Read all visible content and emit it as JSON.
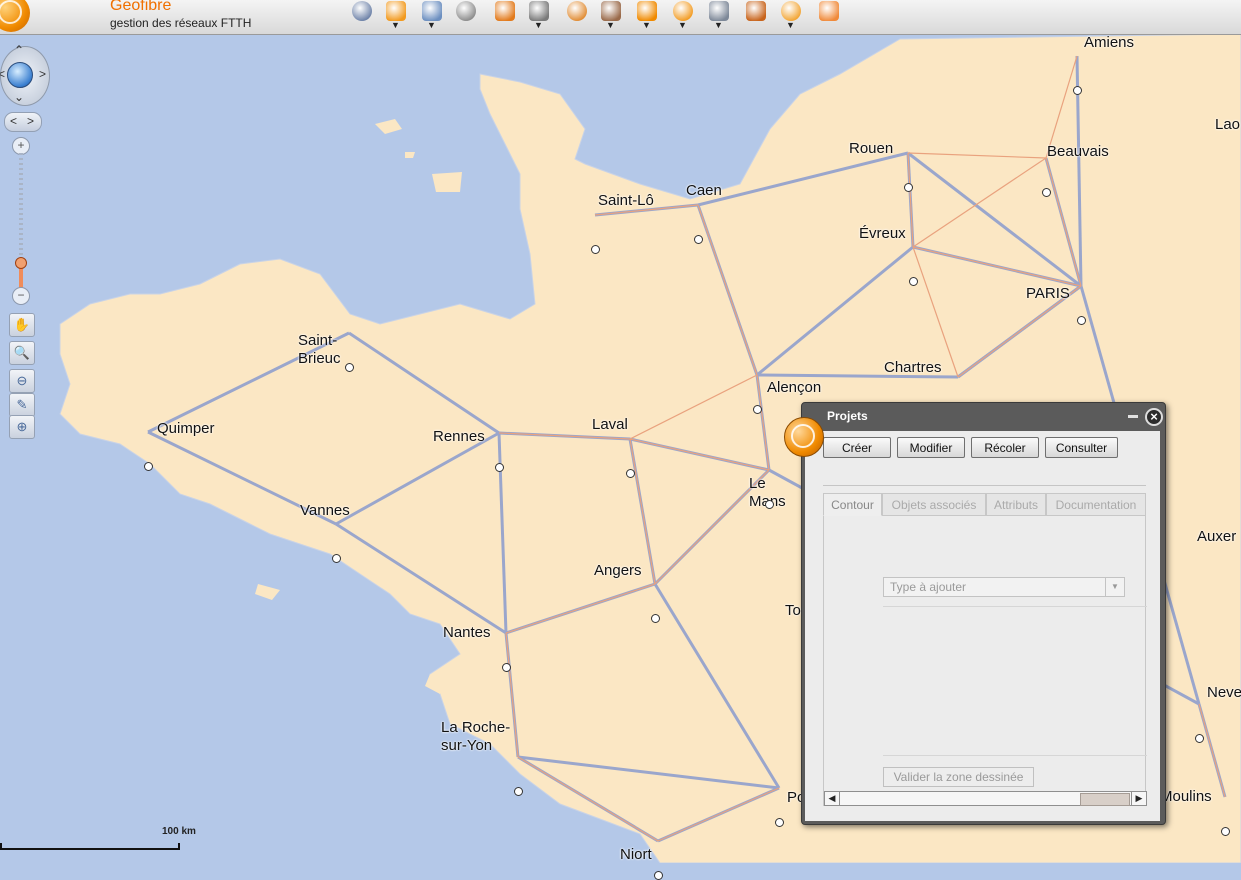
{
  "app": {
    "title": "Geofibre",
    "subtitle": "gestion des réseaux FTTH"
  },
  "toolbar": {
    "tools": [
      {
        "icon": "map-pin-icon",
        "color": "#6a7fa6",
        "dropdown": false
      },
      {
        "icon": "target-icon",
        "color": "#f29a1f",
        "dropdown": true
      },
      {
        "icon": "layers-icon",
        "color": "#6c8fc0",
        "dropdown": true
      },
      {
        "icon": "person-icon",
        "color": "#8a8a8a",
        "dropdown": false
      },
      {
        "icon": "pie-chart-icon",
        "color": "#e27a1c",
        "dropdown": false
      },
      {
        "icon": "wrench-icon",
        "color": "#7a7a7a",
        "dropdown": true
      },
      {
        "icon": "eye-icon",
        "color": "#e08a30",
        "dropdown": false
      },
      {
        "icon": "document-icon",
        "color": "#9a6a4a",
        "dropdown": true
      },
      {
        "icon": "globe-icon",
        "color": "#f08a00",
        "dropdown": true
      },
      {
        "icon": "save-icon",
        "color": "#f29a1f",
        "dropdown": true
      },
      {
        "icon": "print-icon",
        "color": "#7d8898",
        "dropdown": true
      },
      {
        "icon": "basket-icon",
        "color": "#c8641c",
        "dropdown": false
      },
      {
        "icon": "gear-icon",
        "color": "#f2a32f",
        "dropdown": true
      },
      {
        "icon": "users-icon",
        "color": "#f08a3a",
        "dropdown": false
      }
    ],
    "dropdown_glyph": "▼"
  },
  "map": {
    "cities": [
      {
        "name": "Amiens"
      },
      {
        "name": "Lao"
      },
      {
        "name": "Rouen"
      },
      {
        "name": "Beauvais"
      },
      {
        "name": "Saint-Lô"
      },
      {
        "name": "Caen"
      },
      {
        "name": "Évreux"
      },
      {
        "name": "PARIS"
      },
      {
        "name": "Saint-\nBrieuc"
      },
      {
        "name": "Alençon"
      },
      {
        "name": "Chartres"
      },
      {
        "name": "Quimper"
      },
      {
        "name": "Rennes"
      },
      {
        "name": "Laval"
      },
      {
        "name": "Le\nMans"
      },
      {
        "name": "Vannes"
      },
      {
        "name": "Auxer"
      },
      {
        "name": "Angers"
      },
      {
        "name": "To"
      },
      {
        "name": "Nantes"
      },
      {
        "name": "Neve"
      },
      {
        "name": "La Roche-\nsur-Yon"
      },
      {
        "name": "Po"
      },
      {
        "name": "Moulins"
      },
      {
        "name": "Niort"
      }
    ],
    "scale_label": "100 km",
    "colors": {
      "sea": "#b4c8e8",
      "land": "#fbe7c4",
      "road": "#9aa6cc",
      "minor_road": "#e9a27e",
      "border": "#e88ad0"
    }
  },
  "nav": {
    "up": "⌃",
    "down": "⌄",
    "left": "<",
    "right": ">",
    "hist_back": "<",
    "hist_fwd": ">",
    "zoom_in": "+",
    "zoom_out": "−",
    "zoom_level": 0.2
  },
  "side_tools": [
    {
      "icon": "hand-pan-icon",
      "glyph": "✋"
    },
    {
      "icon": "zoom-box-icon",
      "glyph": "🔍"
    },
    {
      "icon": "zoom-out-icon",
      "glyph": "⊖"
    },
    {
      "icon": "eraser-icon",
      "glyph": "✎"
    },
    {
      "icon": "zoom-in-icon",
      "glyph": "⊕"
    }
  ],
  "panel": {
    "title": "Projets",
    "close_glyph": "×",
    "buttons": [
      "Créer",
      "Modifier",
      "Récoler",
      "Consulter"
    ],
    "tabs": [
      "Contour",
      "Objets associés",
      "Attributs",
      "Documentation"
    ],
    "active_tab": "Contour",
    "select_placeholder": "Type à ajouter",
    "select_glyph": "▼",
    "validate_label": "Valider la zone dessinée",
    "scroll_left": "◀",
    "scroll_right": "▶"
  }
}
